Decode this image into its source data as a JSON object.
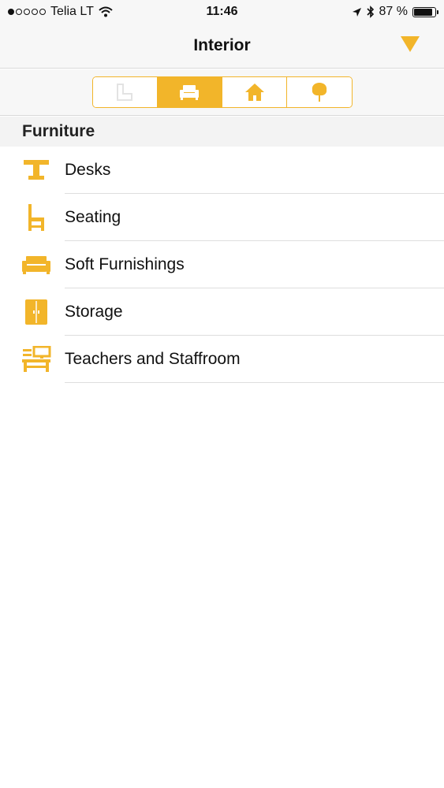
{
  "status": {
    "carrier": "Telia LT",
    "time": "11:46",
    "battery_text": "87 %",
    "battery_level": 0.87
  },
  "nav": {
    "title": "Interior",
    "action_icon": "triangle-down-icon"
  },
  "segments": [
    {
      "icon": "floorplan-icon",
      "active": false
    },
    {
      "icon": "armchair-icon",
      "active": true
    },
    {
      "icon": "house-icon",
      "active": false
    },
    {
      "icon": "tree-icon",
      "active": false
    }
  ],
  "section": {
    "title": "Furniture"
  },
  "items": [
    {
      "label": "Desks",
      "icon": "desk-icon"
    },
    {
      "label": "Seating",
      "icon": "chair-icon"
    },
    {
      "label": "Soft Furnishings",
      "icon": "sofa-icon"
    },
    {
      "label": "Storage",
      "icon": "cabinet-icon"
    },
    {
      "label": "Teachers and Staffroom",
      "icon": "teacher-desk-icon"
    }
  ],
  "colors": {
    "accent": "#f2b52a",
    "bar_background": "#f7f7f7",
    "section_background": "#f3f3f3"
  }
}
